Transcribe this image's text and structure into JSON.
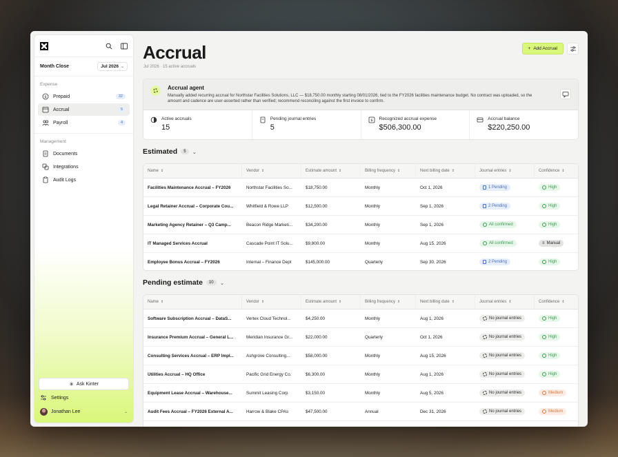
{
  "sidebar": {
    "month_label": "Month Close",
    "month_value": "Jul 2026",
    "section_expense": "Expense",
    "expense_items": [
      {
        "label": "Prepaid",
        "count": "32"
      },
      {
        "label": "Accrual",
        "count": "5"
      },
      {
        "label": "Payroll",
        "count": "4"
      }
    ],
    "section_management": "Management",
    "management_items": [
      {
        "label": "Documents"
      },
      {
        "label": "Integrations"
      },
      {
        "label": "Audit Logs"
      }
    ],
    "ask_label": "Ask Kinter",
    "settings_label": "Settings",
    "user_name": "Jonathan Lee"
  },
  "header": {
    "title": "Accrual",
    "subtitle": "Jul 2026 · 15 active accruals",
    "add_label": "Add Accrual"
  },
  "agent": {
    "title": "Accrual agent",
    "text": "Manually added recurring accrual for Northstar Facilities Solutions, LLC — $18,750.00 monthly starting 08/01/2026, tied to the FY2026 facilities maintenance budget. No contract was uploaded, so the amount and cadence are user-asserted rather than verified; recommend reconciling against the first invoice to confirm."
  },
  "stats": [
    {
      "label": "Active accruals",
      "value": "15"
    },
    {
      "label": "Pending journal entries",
      "value": "5"
    },
    {
      "label": "Recognized accrual expense",
      "value": "$506,300.00"
    },
    {
      "label": "Accrual balance",
      "value": "$220,250.00"
    }
  ],
  "columns": [
    "Name",
    "Vendor",
    "Estimate amount",
    "Billing frequency",
    "Next billing date",
    "Journal entries",
    "Confidence"
  ],
  "estimated": {
    "title": "Estimated",
    "count": "5",
    "rows": [
      {
        "name": "Facilities Maintenance Accrual – FY2026",
        "vendor": "Northstar Facilities So...",
        "amount": "$18,750.00",
        "freq": "Monthly",
        "date": "Oct 1, 2026",
        "journal": "1 Pending",
        "jtype": "pending",
        "conf": "High",
        "ctype": "high"
      },
      {
        "name": "Legal Retainer Accrual – Corporate Cou...",
        "vendor": "Whitfield & Rowe LLP",
        "amount": "$12,500.00",
        "freq": "Monthly",
        "date": "Sep 1, 2026",
        "journal": "2 Pending",
        "jtype": "pending",
        "conf": "High",
        "ctype": "high"
      },
      {
        "name": "Marketing Agency Retainer – Q3 Camp...",
        "vendor": "Beacon Ridge Marketi...",
        "amount": "$34,200.00",
        "freq": "Monthly",
        "date": "Sep 1, 2026",
        "journal": "All confirmed",
        "jtype": "confirmed",
        "conf": "High",
        "ctype": "high"
      },
      {
        "name": "IT Managed Services Accrual",
        "vendor": "Cascade Point IT Solu...",
        "amount": "$9,800.00",
        "freq": "Monthly",
        "date": "Aug 15, 2026",
        "journal": "All confirmed",
        "jtype": "confirmed",
        "conf": "Manual",
        "ctype": "manual"
      },
      {
        "name": "Employee Bonus Accrual – FY2026",
        "vendor": "Internal – Finance Dept",
        "amount": "$145,000.00",
        "freq": "Quarterly",
        "date": "Sep 30, 2026",
        "journal": "2 Pending",
        "jtype": "pending",
        "conf": "High",
        "ctype": "high"
      }
    ]
  },
  "pending": {
    "title": "Pending estimate",
    "count": "10",
    "rows": [
      {
        "name": "Software Subscription Accrual – DataS...",
        "vendor": "Vertex Cloud Technol...",
        "amount": "$4,250.00",
        "freq": "Monthly",
        "date": "Aug 1, 2026",
        "journal": "No journal entries",
        "jtype": "none",
        "conf": "High",
        "ctype": "high"
      },
      {
        "name": "Insurance Premium Accrual – General L...",
        "vendor": "Meridian Insurance Gr...",
        "amount": "$22,000.00",
        "freq": "Quarterly",
        "date": "Oct 1, 2026",
        "journal": "No journal entries",
        "jtype": "none",
        "conf": "High",
        "ctype": "high"
      },
      {
        "name": "Consulting Services Accrual – ERP Impl...",
        "vendor": "Ashgrove Consulting...",
        "amount": "$58,000.00",
        "freq": "Monthly",
        "date": "Aug 15, 2026",
        "journal": "No journal entries",
        "jtype": "none",
        "conf": "High",
        "ctype": "high"
      },
      {
        "name": "Utilities Accrual – HQ Office",
        "vendor": "Pacific Grid Energy Co.",
        "amount": "$6,300.00",
        "freq": "Monthly",
        "date": "Aug 1, 2026",
        "journal": "No journal entries",
        "jtype": "none",
        "conf": "High",
        "ctype": "high"
      },
      {
        "name": "Equipment Lease Accrual – Warehouse...",
        "vendor": "Summit Leasing Corp",
        "amount": "$3,150.00",
        "freq": "Monthly",
        "date": "Aug 5, 2026",
        "journal": "No journal entries",
        "jtype": "none",
        "conf": "Medium",
        "ctype": "medium"
      },
      {
        "name": "Audit Fees Accrual – FY2026 External A...",
        "vendor": "Harrow & Blake CPAs",
        "amount": "$47,500.00",
        "freq": "Annual",
        "date": "Dec 31, 2026",
        "journal": "No journal entries",
        "jtype": "none",
        "conf": "Medium",
        "ctype": "medium"
      }
    ]
  },
  "colors": {
    "accent": "#d9f77a",
    "pending": "#4a6fb5",
    "confirmed": "#3f9a55",
    "medium": "#d4773f"
  }
}
